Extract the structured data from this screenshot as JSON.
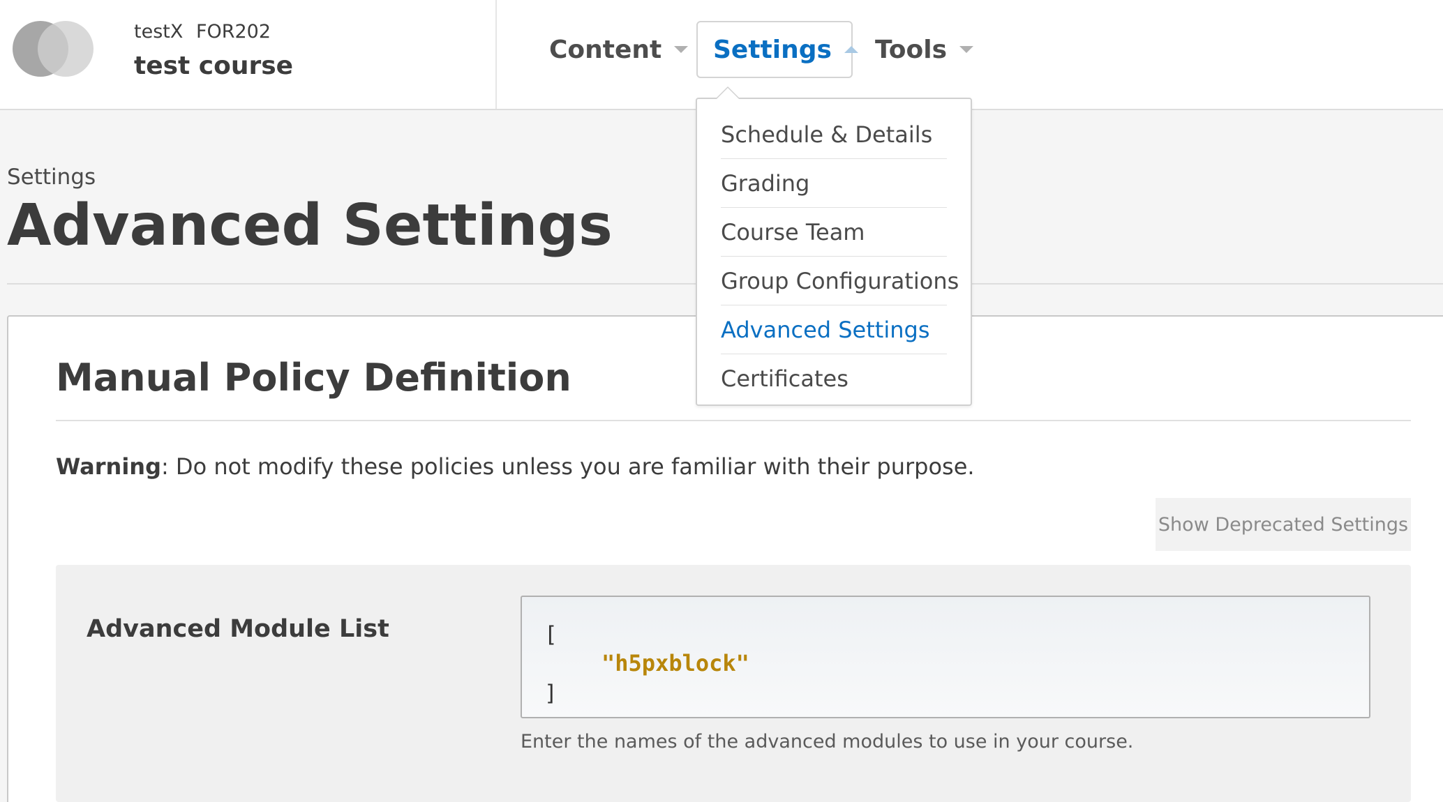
{
  "header": {
    "course_org": "testX",
    "course_number": "FOR202",
    "course_title": "test course"
  },
  "nav": {
    "content": "Content",
    "settings": "Settings",
    "tools": "Tools"
  },
  "settings_menu": {
    "items": [
      "Schedule & Details",
      "Grading",
      "Course Team",
      "Group Configurations",
      "Advanced Settings",
      "Certificates"
    ],
    "current": "Advanced Settings"
  },
  "page": {
    "breadcrumb": "Settings",
    "title": "Advanced Settings"
  },
  "section": {
    "title": "Manual Policy Definition",
    "warning_label": "Warning",
    "warning_text": ": Do not modify these policies unless you are familiar with their purpose.",
    "show_deprecated_label": "Show Deprecated Settings"
  },
  "field": {
    "label": "Advanced Module List",
    "code_open": "[",
    "code_value": "\"h5pxblock\"",
    "code_close": "]",
    "help": "Enter the names of the advanced modules to use in your course."
  },
  "colors": {
    "accent": "#0a6fc2",
    "code_string": "#b8860b"
  }
}
